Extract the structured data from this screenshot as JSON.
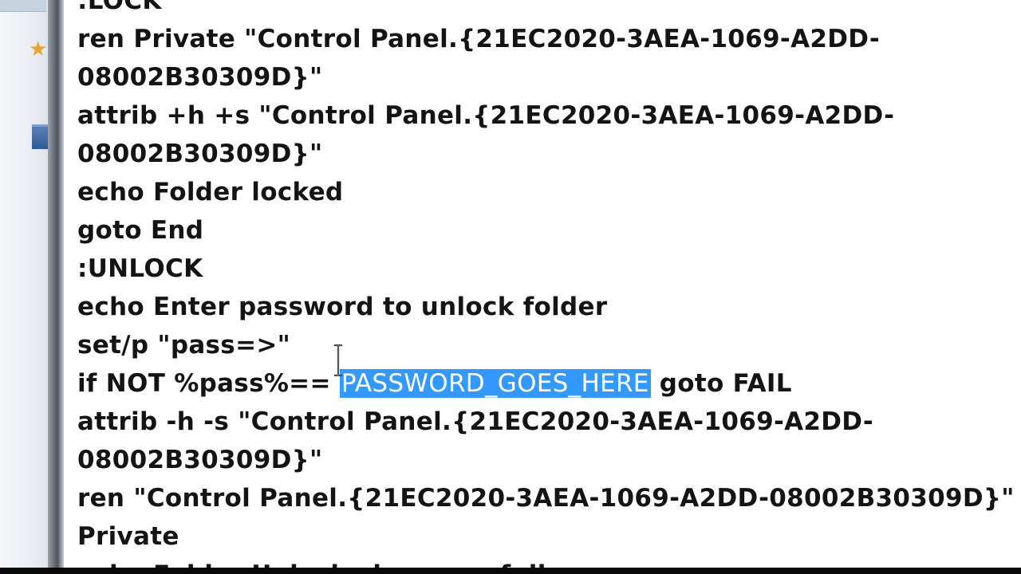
{
  "desktop": {
    "star_icon": "star-icon",
    "tab_icon": "blue-tab-icon"
  },
  "editor": {
    "lines": [
      ":LOCK",
      "ren Private \"Control Panel.{21EC2020-3AEA-1069-A2DD-",
      "08002B30309D}\"",
      "attrib +h +s \"Control Panel.{21EC2020-3AEA-1069-A2DD-",
      "08002B30309D}\"",
      "echo Folder locked",
      "goto End",
      ":UNLOCK",
      "echo Enter password to unlock folder",
      "set/p \"pass=>\"",
      {
        "before": "if NOT %pass%== ",
        "selected": "PASSWORD_GOES_HERE",
        "after": " goto FAIL"
      },
      "attrib -h -s \"Control Panel.{21EC2020-3AEA-1069-A2DD-",
      "08002B30309D}\"",
      "ren \"Control Panel.{21EC2020-3AEA-1069-A2DD-08002B30309D}\"",
      "Private",
      "echo Folder Unlocked successfully"
    ],
    "selection_color": "#3399ff",
    "cursor_icon": "ibeam-cursor-icon"
  }
}
